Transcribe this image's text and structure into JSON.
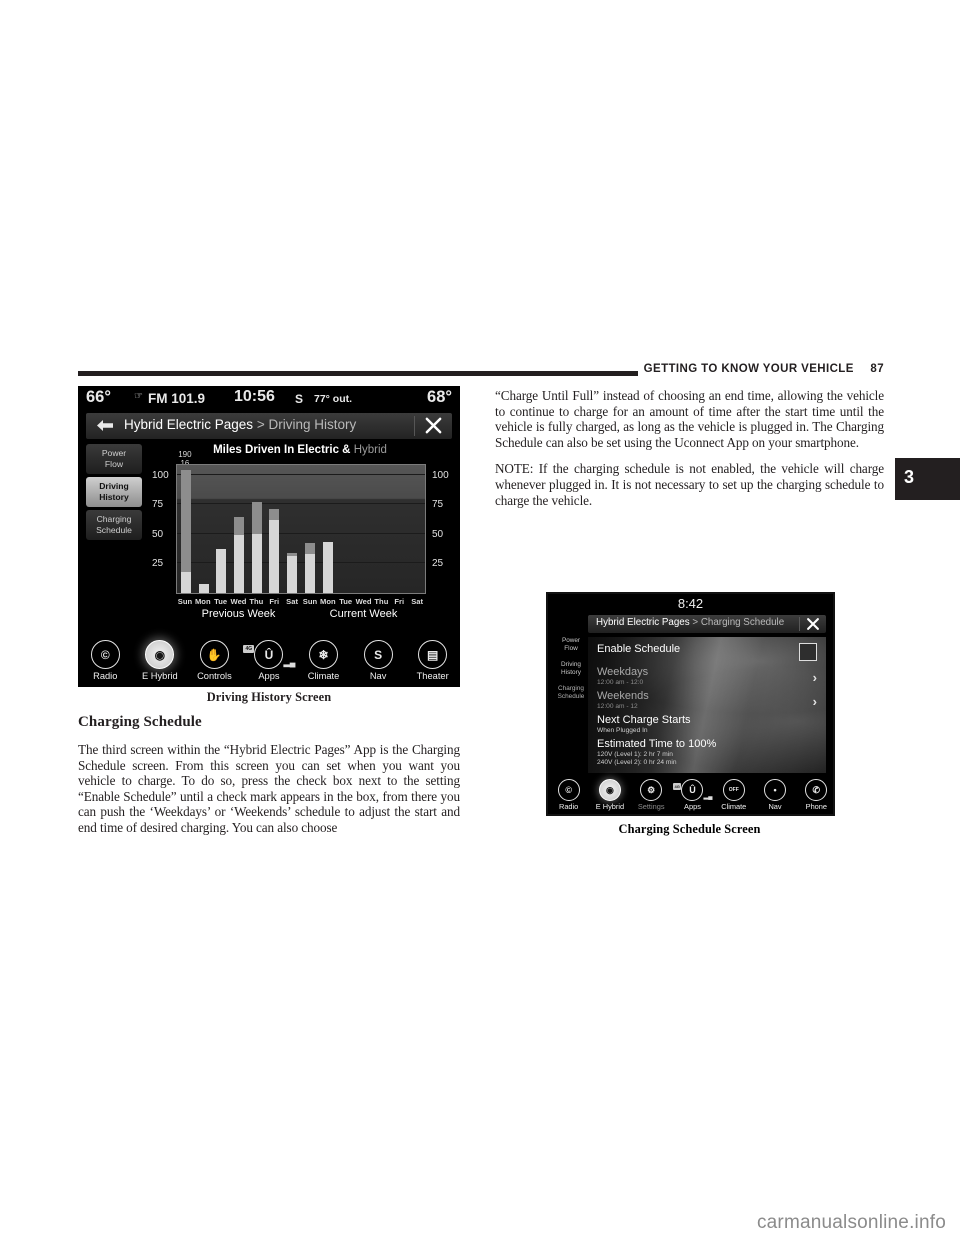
{
  "header": {
    "chapter_title": "GETTING TO KNOW YOUR VEHICLE",
    "page_number": "87",
    "chapter_tab": "3"
  },
  "watermark": "carmanualsonline.info",
  "left_column": {
    "figure_caption": "Driving History Screen",
    "subheading": "Charging Schedule",
    "body": "The third screen within the “Hybrid Electric Pages” App is the Charging Schedule screen. From this screen you can set when you want you vehicle to charge. To do so, press the check box next to the setting “Enable Schedule” until a check mark appears in the box, from there you can push the ‘Weekdays’ or ‘Weekends’ schedule to adjust the start and end time of desired charging. You can also choose"
  },
  "right_column": {
    "body": "“Charge Until Full” instead of choosing an end time, allowing the vehicle to continue to charge for an amount of time after the start time until the vehicle is fully charged, as long as the vehicle is plugged in. The Charging Schedule can also be set using the Uconnect App on your smartphone.",
    "note": "NOTE: If the charging schedule is not enabled, the vehicle will charge whenever plugged in. It is not necessary to set up the charging schedule to charge the vehicle.",
    "figure_caption": "Charging Schedule Screen"
  },
  "screen1": {
    "status_bar": {
      "left_temp": "66°",
      "radio_source": "FM 101.9",
      "clock": "10:56",
      "am_pm_or_mode": "S",
      "outside_temp": "77° out.",
      "right_temp": "68°"
    },
    "title_bar": {
      "breadcrumb_root": "Hybrid Electric Pages",
      "separator": " > ",
      "breadcrumb_current": "Driving History"
    },
    "side_menu": [
      {
        "label": "Power\nFlow",
        "selected": false
      },
      {
        "label": "Driving\nHistory",
        "selected": true
      },
      {
        "label": "Charging\nSchedule",
        "selected": false
      }
    ],
    "chart_title_prefix": "Miles Driven In ",
    "chart_title_electric": "Electric",
    "chart_title_amp": " & ",
    "chart_title_hybrid": "Hybrid",
    "icon_bar": [
      {
        "label": "Radio",
        "icon": "radio-tower-icon",
        "glyph": "©",
        "active": false
      },
      {
        "label": "E Hybrid",
        "icon": "e-hybrid-leaf-icon",
        "glyph": "◉",
        "active": true
      },
      {
        "label": "Controls",
        "icon": "controls-hand-icon",
        "glyph": "✋",
        "active": false
      },
      {
        "label": "Apps",
        "icon": "uconnect-apps-icon",
        "glyph": "Û",
        "active": false,
        "badge": "4G",
        "signal": "▂▄"
      },
      {
        "label": "Climate",
        "icon": "climate-fan-icon",
        "glyph": "❄",
        "active": false
      },
      {
        "label": "Nav",
        "icon": "nav-compass-icon",
        "glyph": "S",
        "active": false
      },
      {
        "label": "Theater",
        "icon": "theater-film-icon",
        "glyph": "▤",
        "active": false
      }
    ]
  },
  "screen2": {
    "clock": "8:42",
    "title_bar": {
      "breadcrumb_root": "Hybrid Electric Pages",
      "separator": " > ",
      "breadcrumb_current": "Charging Schedule"
    },
    "side_menu": [
      {
        "label": "Power\nFlow",
        "selected": false
      },
      {
        "label": "Driving\nHistory",
        "selected": false
      },
      {
        "label": "Charging\nSchedule",
        "selected": true
      }
    ],
    "rows": [
      {
        "title": "Enable Schedule",
        "subtitle": "",
        "control": "checkbox",
        "faded": false
      },
      {
        "title": "Weekdays",
        "subtitle": "12:00 am - 12:0",
        "control": "chevron",
        "faded": true
      },
      {
        "title": "Weekends",
        "subtitle": "12:00 am - 12",
        "control": "chevron",
        "faded": true
      },
      {
        "title": "Next Charge Starts",
        "subtitle": "When Plugged In",
        "control": "none",
        "faded": false
      },
      {
        "title": "Estimated Time to 100%",
        "subtitle": "120V (Level 1): 2 hr 7 min",
        "subtitle2": "240V (Level 2): 0 hr 24 min",
        "control": "none",
        "faded": false
      }
    ],
    "icon_bar": [
      {
        "label": "Radio",
        "icon": "radio-tower-icon",
        "glyph": "©",
        "active": false
      },
      {
        "label": "E Hybrid",
        "icon": "e-hybrid-leaf-icon",
        "glyph": "◉",
        "active": true
      },
      {
        "label": "Settings",
        "icon": "gear-icon",
        "glyph": "⚙",
        "active": false,
        "dim": true
      },
      {
        "label": "Apps",
        "icon": "uconnect-apps-icon",
        "glyph": "Û",
        "active": false,
        "badge": "4G",
        "signal": "▂▄"
      },
      {
        "label": "Climate",
        "icon": "climate-off-icon",
        "glyph": "OFF",
        "active": false
      },
      {
        "label": "Nav",
        "icon": "nav-compass-icon",
        "glyph": "•",
        "active": false
      },
      {
        "label": "Phone",
        "icon": "phone-handset-icon",
        "glyph": "✆",
        "active": false
      }
    ]
  },
  "chart_data": {
    "type": "bar",
    "title": "Miles Driven In Electric & Hybrid",
    "xlabel": "",
    "ylabel": "",
    "ylim": [
      0,
      110
    ],
    "yticks": [
      25,
      50,
      75,
      100
    ],
    "grid": true,
    "legend": [
      "Electric",
      "Hybrid"
    ],
    "stacked": true,
    "axis_right_mirrored": true,
    "groups": [
      "Previous Week",
      "Current Week"
    ],
    "categories": [
      "Sun",
      "Mon",
      "Tue",
      "Wed",
      "Thu",
      "Fri",
      "Sat",
      "Sun",
      "Mon",
      "Tue",
      "Wed",
      "Thu",
      "Fri",
      "Sat"
    ],
    "annotations": [
      {
        "text": "190",
        "bar": "Sun (Previous Week)"
      },
      {
        "text": "16",
        "bar": "Sun (Previous Week)"
      }
    ],
    "series": [
      {
        "name": "Electric",
        "values": [
          18,
          8,
          37,
          49,
          50,
          62,
          31,
          33,
          43,
          0,
          0,
          0,
          0,
          0
        ]
      },
      {
        "name": "Hybrid",
        "values": [
          86,
          0,
          0,
          15,
          27,
          9,
          3,
          9,
          0,
          0,
          0,
          0,
          0,
          0
        ]
      }
    ]
  }
}
